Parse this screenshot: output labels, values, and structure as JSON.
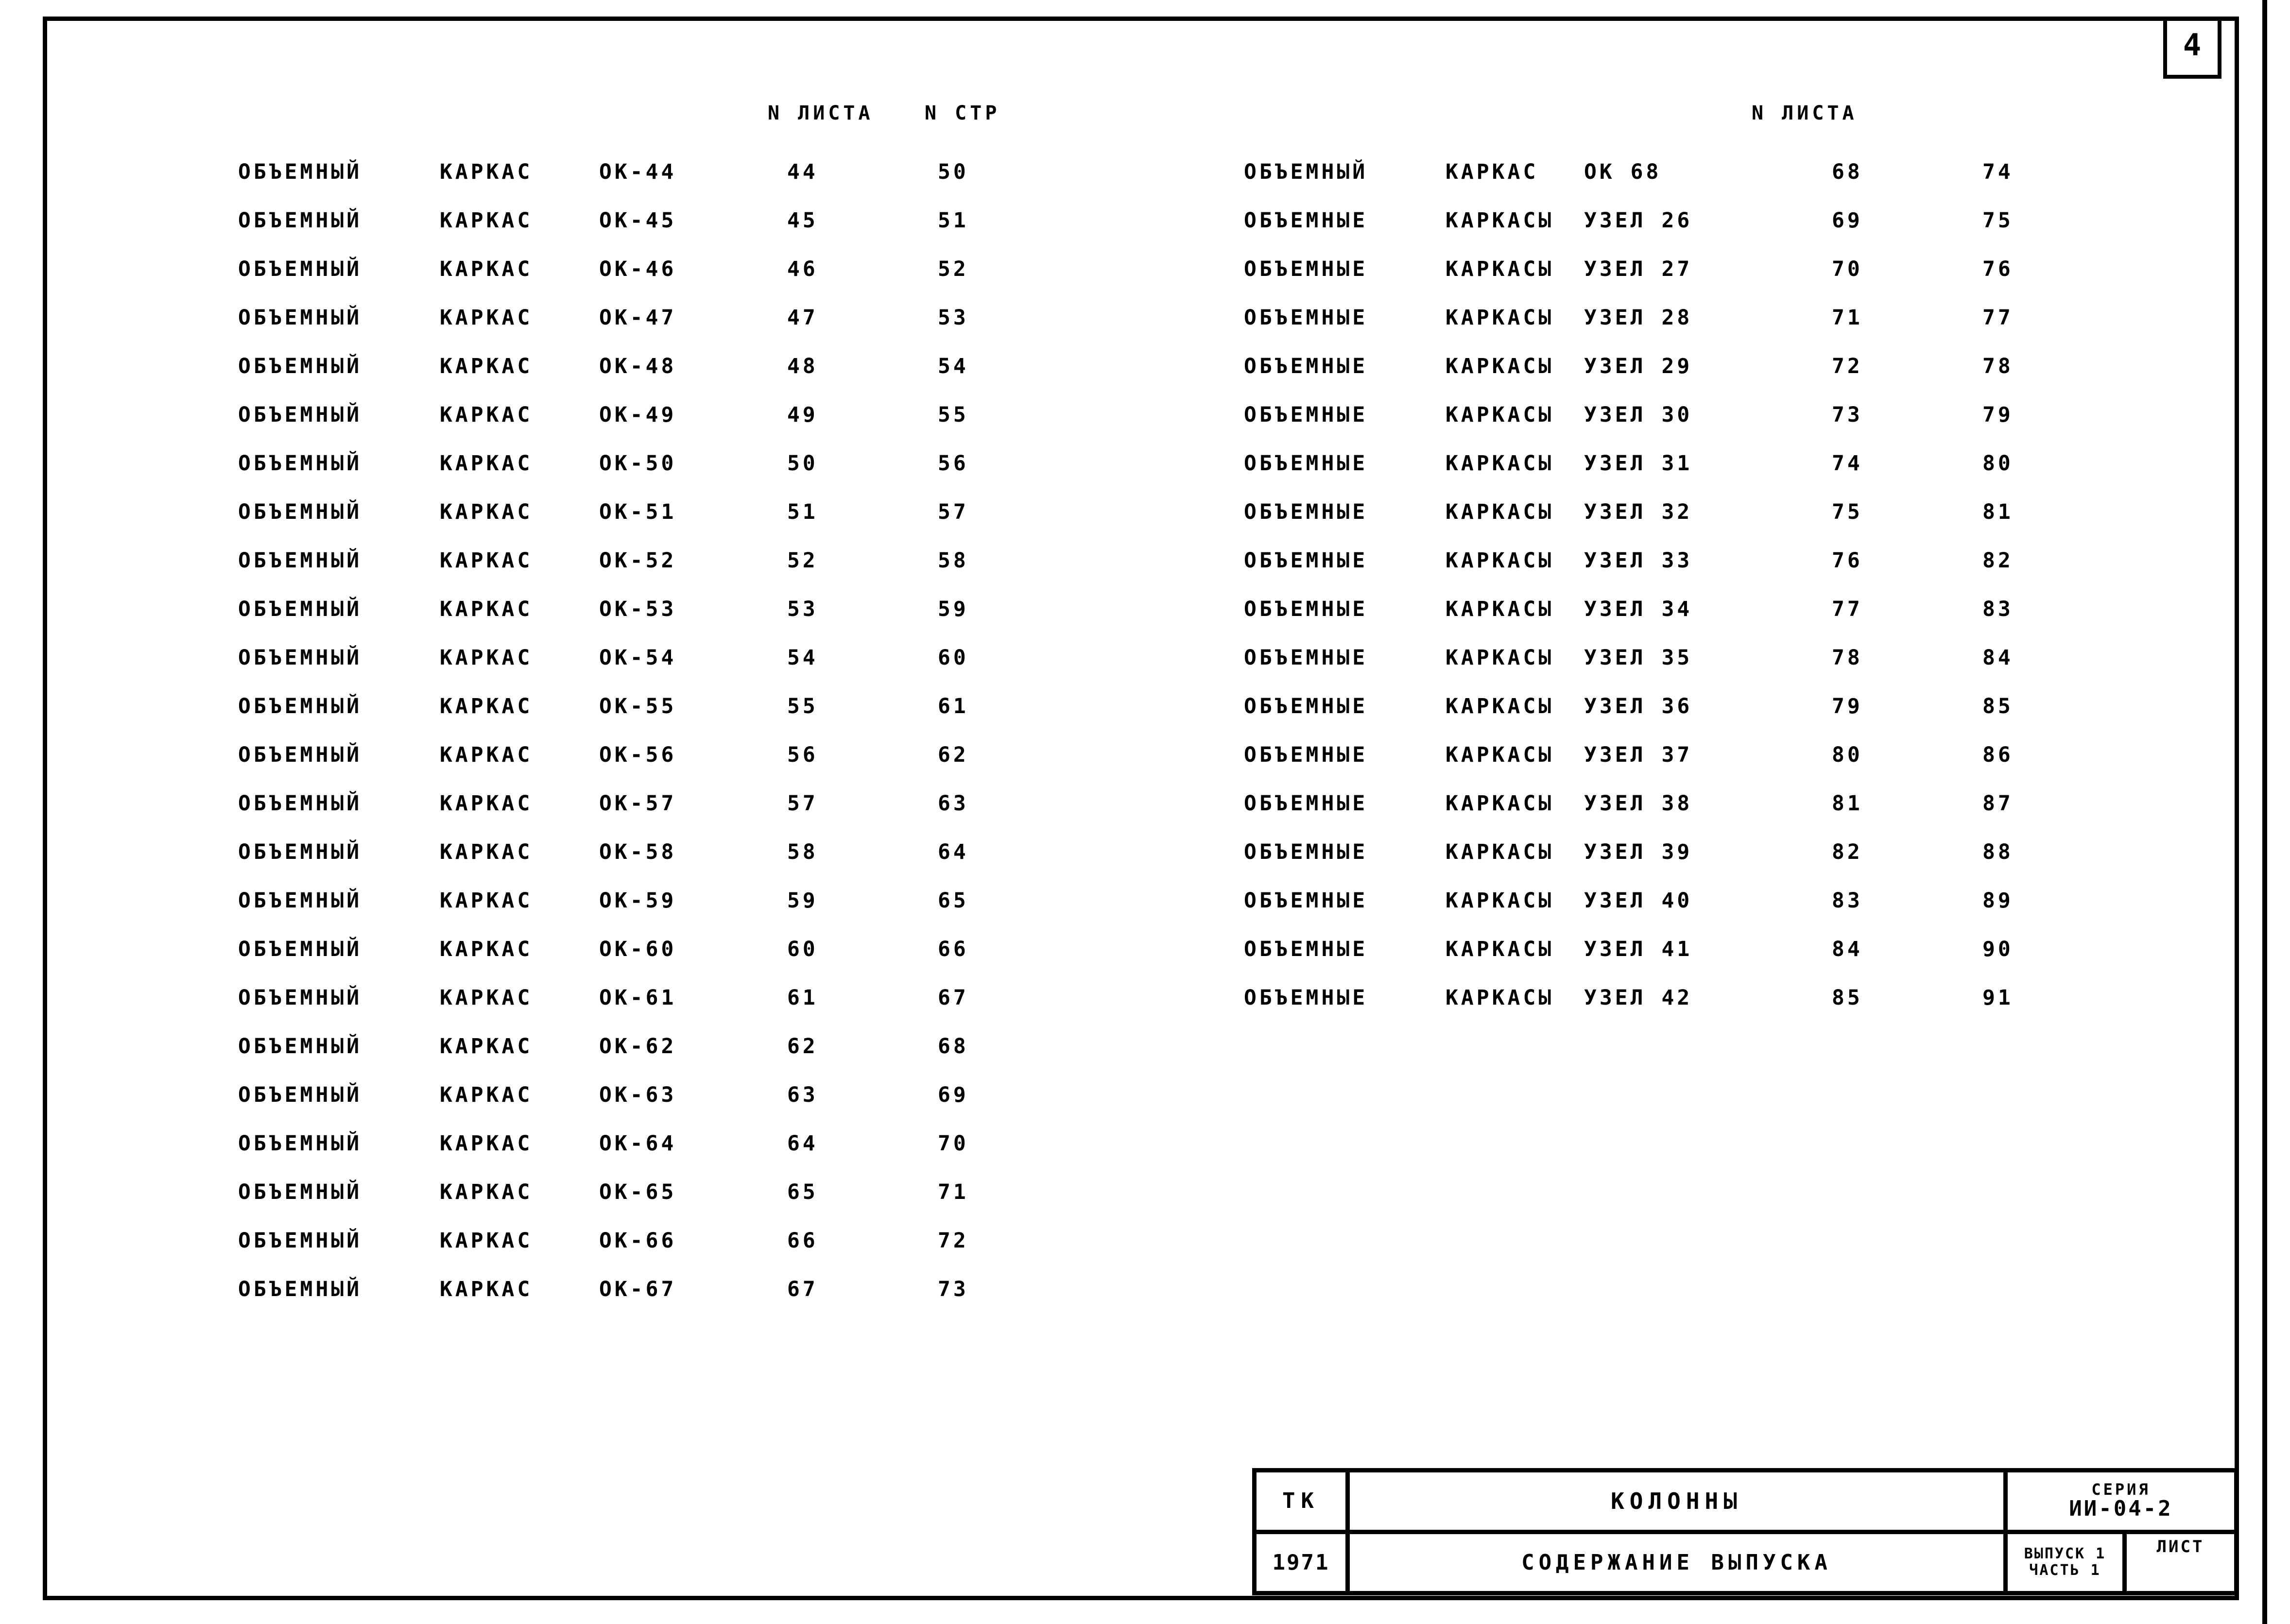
{
  "sheet": {
    "corner_page_number": "4"
  },
  "headers": {
    "left_sheet": "N ЛИСТА",
    "left_page": "N СТР",
    "right_sheet": "N ЛИСТА"
  },
  "left_column": [
    {
      "name": "ОБЪЕМНЫЙ",
      "type": "КАРКАС",
      "mark": "ОК-44",
      "sheet": "44",
      "page": "50"
    },
    {
      "name": "ОБЪЕМНЫЙ",
      "type": "КАРКАС",
      "mark": "ОК-45",
      "sheet": "45",
      "page": "51"
    },
    {
      "name": "ОБЪЕМНЫЙ",
      "type": "КАРКАС",
      "mark": "ОК-46",
      "sheet": "46",
      "page": "52"
    },
    {
      "name": "ОБЪЕМНЫЙ",
      "type": "КАРКАС",
      "mark": "ОК-47",
      "sheet": "47",
      "page": "53"
    },
    {
      "name": "ОБЪЕМНЫЙ",
      "type": "КАРКАС",
      "mark": "ОК-48",
      "sheet": "48",
      "page": "54"
    },
    {
      "name": "ОБЪЕМНЫЙ",
      "type": "КАРКАС",
      "mark": "ОК-49",
      "sheet": "49",
      "page": "55"
    },
    {
      "name": "ОБЪЕМНЫЙ",
      "type": "КАРКАС",
      "mark": "ОК-50",
      "sheet": "50",
      "page": "56"
    },
    {
      "name": "ОБЪЕМНЫЙ",
      "type": "КАРКАС",
      "mark": "ОК-51",
      "sheet": "51",
      "page": "57"
    },
    {
      "name": "ОБЪЕМНЫЙ",
      "type": "КАРКАС",
      "mark": "ОК-52",
      "sheet": "52",
      "page": "58"
    },
    {
      "name": "ОБЪЕМНЫЙ",
      "type": "КАРКАС",
      "mark": "ОК-53",
      "sheet": "53",
      "page": "59"
    },
    {
      "name": "ОБЪЕМНЫЙ",
      "type": "КАРКАС",
      "mark": "ОК-54",
      "sheet": "54",
      "page": "60"
    },
    {
      "name": "ОБЪЕМНЫЙ",
      "type": "КАРКАС",
      "mark": "ОК-55",
      "sheet": "55",
      "page": "61"
    },
    {
      "name": "ОБЪЕМНЫЙ",
      "type": "КАРКАС",
      "mark": "ОК-56",
      "sheet": "56",
      "page": "62"
    },
    {
      "name": "ОБЪЕМНЫЙ",
      "type": "КАРКАС",
      "mark": "ОК-57",
      "sheet": "57",
      "page": "63"
    },
    {
      "name": "ОБЪЕМНЫЙ",
      "type": "КАРКАС",
      "mark": "ОК-58",
      "sheet": "58",
      "page": "64"
    },
    {
      "name": "ОБЪЕМНЫЙ",
      "type": "КАРКАС",
      "mark": "ОК-59",
      "sheet": "59",
      "page": "65"
    },
    {
      "name": "ОБЪЕМНЫЙ",
      "type": "КАРКАС",
      "mark": "ОК-60",
      "sheet": "60",
      "page": "66"
    },
    {
      "name": "ОБЪЕМНЫЙ",
      "type": "КАРКАС",
      "mark": "ОК-61",
      "sheet": "61",
      "page": "67"
    },
    {
      "name": "ОБЪЕМНЫЙ",
      "type": "КАРКАС",
      "mark": "ОК-62",
      "sheet": "62",
      "page": "68"
    },
    {
      "name": "ОБЪЕМНЫЙ",
      "type": "КАРКАС",
      "mark": "ОК-63",
      "sheet": "63",
      "page": "69"
    },
    {
      "name": "ОБЪЕМНЫЙ",
      "type": "КАРКАС",
      "mark": "ОК-64",
      "sheet": "64",
      "page": "70"
    },
    {
      "name": "ОБЪЕМНЫЙ",
      "type": "КАРКАС",
      "mark": "ОК-65",
      "sheet": "65",
      "page": "71"
    },
    {
      "name": "ОБЪЕМНЫЙ",
      "type": "КАРКАС",
      "mark": "ОК-66",
      "sheet": "66",
      "page": "72"
    },
    {
      "name": "ОБЪЕМНЫЙ",
      "type": "КАРКАС",
      "mark": "ОК-67",
      "sheet": "67",
      "page": "73"
    }
  ],
  "right_column": [
    {
      "name": "ОБЪЕМНЫЙ",
      "type": "КАРКАС",
      "mark": "ОК 68",
      "sheet": "68",
      "page": "74"
    },
    {
      "name": "ОБЪЕМНЫЕ",
      "type": "КАРКАСЫ",
      "mark": "УЗЕЛ 26",
      "sheet": "69",
      "page": "75"
    },
    {
      "name": "ОБЪЕМНЫЕ",
      "type": "КАРКАСЫ",
      "mark": "УЗЕЛ 27",
      "sheet": "70",
      "page": "76"
    },
    {
      "name": "ОБЪЕМНЫЕ",
      "type": "КАРКАСЫ",
      "mark": "УЗЕЛ 28",
      "sheet": "71",
      "page": "77"
    },
    {
      "name": "ОБЪЕМНЫЕ",
      "type": "КАРКАСЫ",
      "mark": "УЗЕЛ 29",
      "sheet": "72",
      "page": "78"
    },
    {
      "name": "ОБЪЕМНЫЕ",
      "type": "КАРКАСЫ",
      "mark": "УЗЕЛ 30",
      "sheet": "73",
      "page": "79"
    },
    {
      "name": "ОБЪЕМНЫЕ",
      "type": "КАРКАСЫ",
      "mark": "УЗЕЛ 31",
      "sheet": "74",
      "page": "80"
    },
    {
      "name": "ОБЪЕМНЫЕ",
      "type": "КАРКАСЫ",
      "mark": "УЗЕЛ 32",
      "sheet": "75",
      "page": "81"
    },
    {
      "name": "ОБЪЕМНЫЕ",
      "type": "КАРКАСЫ",
      "mark": "УЗЕЛ 33",
      "sheet": "76",
      "page": "82"
    },
    {
      "name": "ОБЪЕМНЫЕ",
      "type": "КАРКАСЫ",
      "mark": "УЗЕЛ 34",
      "sheet": "77",
      "page": "83"
    },
    {
      "name": "ОБЪЕМНЫЕ",
      "type": "КАРКАСЫ",
      "mark": "УЗЕЛ 35",
      "sheet": "78",
      "page": "84"
    },
    {
      "name": "ОБЪЕМНЫЕ",
      "type": "КАРКАСЫ",
      "mark": "УЗЕЛ 36",
      "sheet": "79",
      "page": "85"
    },
    {
      "name": "ОБЪЕМНЫЕ",
      "type": "КАРКАСЫ",
      "mark": "УЗЕЛ 37",
      "sheet": "80",
      "page": "86"
    },
    {
      "name": "ОБЪЕМНЫЕ",
      "type": "КАРКАСЫ",
      "mark": "УЗЕЛ 38",
      "sheet": "81",
      "page": "87"
    },
    {
      "name": "ОБЪЕМНЫЕ",
      "type": "КАРКАСЫ",
      "mark": "УЗЕЛ 39",
      "sheet": "82",
      "page": "88"
    },
    {
      "name": "ОБЪЕМНЫЕ",
      "type": "КАРКАСЫ",
      "mark": "УЗЕЛ 40",
      "sheet": "83",
      "page": "89"
    },
    {
      "name": "ОБЪЕМНЫЕ",
      "type": "КАРКАСЫ",
      "mark": "УЗЕЛ 41",
      "sheet": "84",
      "page": "90"
    },
    {
      "name": "ОБЪЕМНЫЕ",
      "type": "КАРКАСЫ",
      "mark": "УЗЕЛ 42",
      "sheet": "85",
      "page": "91"
    }
  ],
  "title_block": {
    "organization": "ТК",
    "year": "1971",
    "main_title": "КОЛОННЫ",
    "subtitle": "СОДЕРЖАНИЕ ВЫПУСКА",
    "series_label": "СЕРИЯ",
    "series_value": "ИИ-04-2",
    "issue_line1": "ВЫПУСК 1",
    "issue_line2": "ЧАСТЬ 1",
    "list_label": "ЛИСТ",
    "list_value": ""
  }
}
